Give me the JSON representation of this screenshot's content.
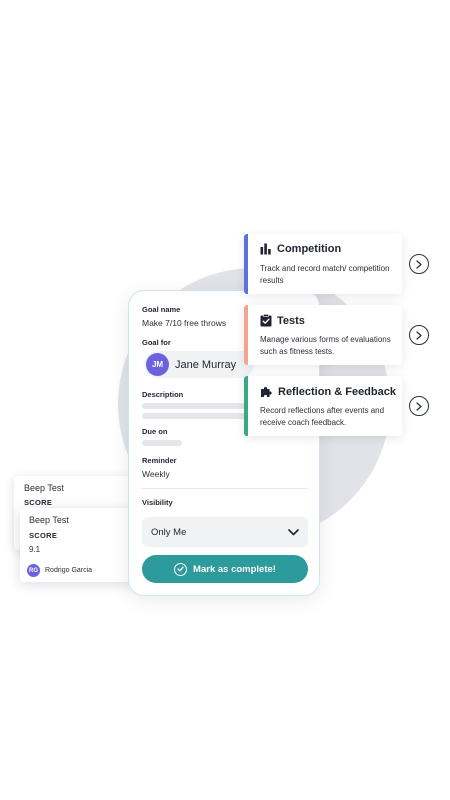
{
  "phone": {
    "goal_name_label": "Goal name",
    "goal_name_value": "Make 7/10 free throws",
    "goal_for_label": "Goal for",
    "avatar_initials": "JM",
    "avatar_name": "Jane Murray",
    "description_label": "Description",
    "due_on_label": "Due on",
    "reminder_label": "Reminder",
    "reminder_value": "Weekly",
    "visibility_label": "Visibility",
    "visibility_value": "Only Me",
    "complete_button": "Mark as complete!"
  },
  "test_cards": {
    "back": {
      "title": "Beep Test",
      "score_label": "SCORE"
    },
    "front": {
      "title": "Beep Test",
      "score_label": "SCORE",
      "score_value": "9.1",
      "user_initials": "RG",
      "user_name": "Rodrigo Garcia"
    }
  },
  "features": [
    {
      "title": "Competition",
      "description": "Track and record match/ competition results",
      "icon": "bar-chart-icon",
      "accent": "#5a72e0"
    },
    {
      "title": "Tests",
      "description": "Manage various forms of evaluations such as fitness tests.",
      "icon": "clipboard-check-icon",
      "accent": "#f0a58e"
    },
    {
      "title": "Reflection & Feedback",
      "description": "Record reflections after events and receive coach feedback.",
      "icon": "puzzle-icon",
      "accent": "#3aa882"
    }
  ],
  "colors": {
    "button": "#2d9b9c",
    "avatar": "#6c62e0",
    "background_circle": "#e1e3e8"
  }
}
